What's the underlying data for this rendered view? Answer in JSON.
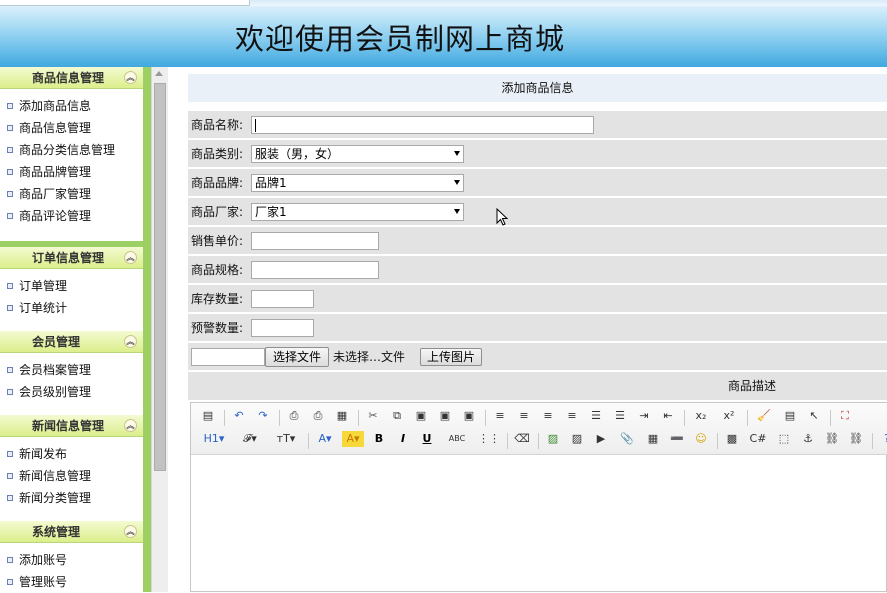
{
  "banner": {
    "title": "欢迎使用会员制网上商城"
  },
  "sidebar": {
    "groups": [
      {
        "title": "商品信息管理",
        "items": [
          "添加商品信息",
          "商品信息管理",
          "商品分类信息管理",
          "商品品牌管理",
          "商品厂家管理",
          "商品评论管理"
        ]
      },
      {
        "title": "订单信息管理",
        "items": [
          "订单管理",
          "订单统计"
        ]
      },
      {
        "title": "会员管理",
        "items": [
          "会员档案管理",
          "会员级别管理"
        ]
      },
      {
        "title": "新闻信息管理",
        "items": [
          "新闻发布",
          "新闻信息管理",
          "新闻分类管理"
        ]
      },
      {
        "title": "系统管理",
        "items": [
          "添加账号",
          "管理账号"
        ]
      }
    ]
  },
  "form": {
    "header": "添加商品信息",
    "name_label": "商品名称:",
    "name_value": "",
    "category_label": "商品类别:",
    "category_value": "服装（男，女）",
    "brand_label": "商品品牌:",
    "brand_value": "品牌1",
    "maker_label": "商品厂家:",
    "maker_value": "厂家1",
    "price_label": "销售单价:",
    "price_value": "",
    "spec_label": "商品规格:",
    "spec_value": "",
    "stock_label": "库存数量:",
    "stock_value": "",
    "warn_label": "预警数量:",
    "warn_value": "",
    "file_button": "选择文件",
    "file_status": "未选择…文件",
    "upload_button": "上传图片",
    "desc_header": "商品描述"
  },
  "editor": {
    "row1": [
      {
        "name": "source-icon",
        "glyph": "▤"
      },
      {
        "name": "undo-icon",
        "glyph": "↶"
      },
      {
        "name": "redo-icon",
        "glyph": "↷"
      },
      {
        "name": "preview-icon",
        "glyph": "⎙"
      },
      {
        "name": "print-icon",
        "glyph": "⎙"
      },
      {
        "name": "template-icon",
        "glyph": "▦"
      },
      {
        "name": "cut-icon",
        "glyph": "✂"
      },
      {
        "name": "copy-icon",
        "glyph": "⧉"
      },
      {
        "name": "paste-icon",
        "glyph": "▣"
      },
      {
        "name": "paste-text-icon",
        "glyph": "▣"
      },
      {
        "name": "paste-word-icon",
        "glyph": "▣"
      },
      {
        "name": "align-left-icon",
        "glyph": "≡"
      },
      {
        "name": "align-center-icon",
        "glyph": "≡"
      },
      {
        "name": "align-right-icon",
        "glyph": "≡"
      },
      {
        "name": "align-justify-icon",
        "glyph": "≡"
      },
      {
        "name": "ordered-list-icon",
        "glyph": "☰"
      },
      {
        "name": "unordered-list-icon",
        "glyph": "☰"
      },
      {
        "name": "indent-icon",
        "glyph": "⇥"
      },
      {
        "name": "outdent-icon",
        "glyph": "⇤"
      },
      {
        "name": "subscript-icon",
        "glyph": "x₂"
      },
      {
        "name": "superscript-icon",
        "glyph": "x²"
      },
      {
        "name": "clear-format-icon",
        "glyph": "🧹"
      },
      {
        "name": "select-all-icon",
        "glyph": "▤"
      },
      {
        "name": "pointer-icon",
        "glyph": "↖"
      },
      {
        "name": "fullscreen-icon",
        "glyph": "⛶"
      }
    ],
    "row2": [
      {
        "name": "heading-icon",
        "glyph": "H1▾"
      },
      {
        "name": "font-family-icon",
        "glyph": "𝓕▾"
      },
      {
        "name": "font-size-icon",
        "glyph": "тT▾"
      },
      {
        "name": "font-color-icon",
        "glyph": "A▾"
      },
      {
        "name": "highlight-icon",
        "glyph": "A▾"
      },
      {
        "name": "bold-icon",
        "glyph": "B"
      },
      {
        "name": "italic-icon",
        "glyph": "I"
      },
      {
        "name": "underline-icon",
        "glyph": "U"
      },
      {
        "name": "strikethrough-icon",
        "glyph": "ABC"
      },
      {
        "name": "line-height-icon",
        "glyph": "⋮⋮"
      },
      {
        "name": "eraser-icon",
        "glyph": "⌫"
      },
      {
        "name": "image-icon",
        "glyph": "▨"
      },
      {
        "name": "multi-image-icon",
        "glyph": "▨"
      },
      {
        "name": "flash-icon",
        "glyph": "▶"
      },
      {
        "name": "attachment-icon",
        "glyph": "📎"
      },
      {
        "name": "table-icon",
        "glyph": "▦"
      },
      {
        "name": "hr-icon",
        "glyph": "➖"
      },
      {
        "name": "emoticon-icon",
        "glyph": "☺"
      },
      {
        "name": "baidu-map-icon",
        "glyph": "▩"
      },
      {
        "name": "code-icon",
        "glyph": "C#"
      },
      {
        "name": "page-break-icon",
        "glyph": "⬚"
      },
      {
        "name": "anchor-icon",
        "glyph": "⚓"
      },
      {
        "name": "link-icon",
        "glyph": "⛓"
      },
      {
        "name": "unlink-icon",
        "glyph": "⛓"
      },
      {
        "name": "help-icon",
        "glyph": "?"
      }
    ]
  }
}
